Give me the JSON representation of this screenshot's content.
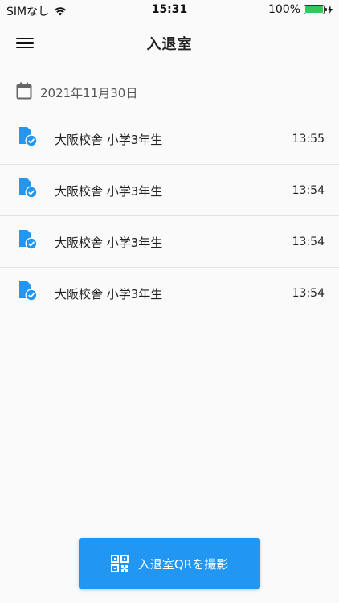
{
  "status_bar": {
    "carrier": "SIMなし",
    "time": "15:31",
    "battery_percent": "100%",
    "battery_level": 1.0
  },
  "header": {
    "title": "入退室"
  },
  "date_row": {
    "date": "2021年11月30日"
  },
  "list": {
    "items": [
      {
        "label": "大阪校舎 小学3年生",
        "time": "13:55"
      },
      {
        "label": "大阪校舎 小学3年生",
        "time": "13:54"
      },
      {
        "label": "大阪校舎 小学3年生",
        "time": "13:54"
      },
      {
        "label": "大阪校舎 小学3年生",
        "time": "13:54"
      }
    ]
  },
  "footer": {
    "qr_button_label": "入退室QRを撮影"
  },
  "colors": {
    "accent": "#2196f3",
    "battery": "#34c759"
  }
}
